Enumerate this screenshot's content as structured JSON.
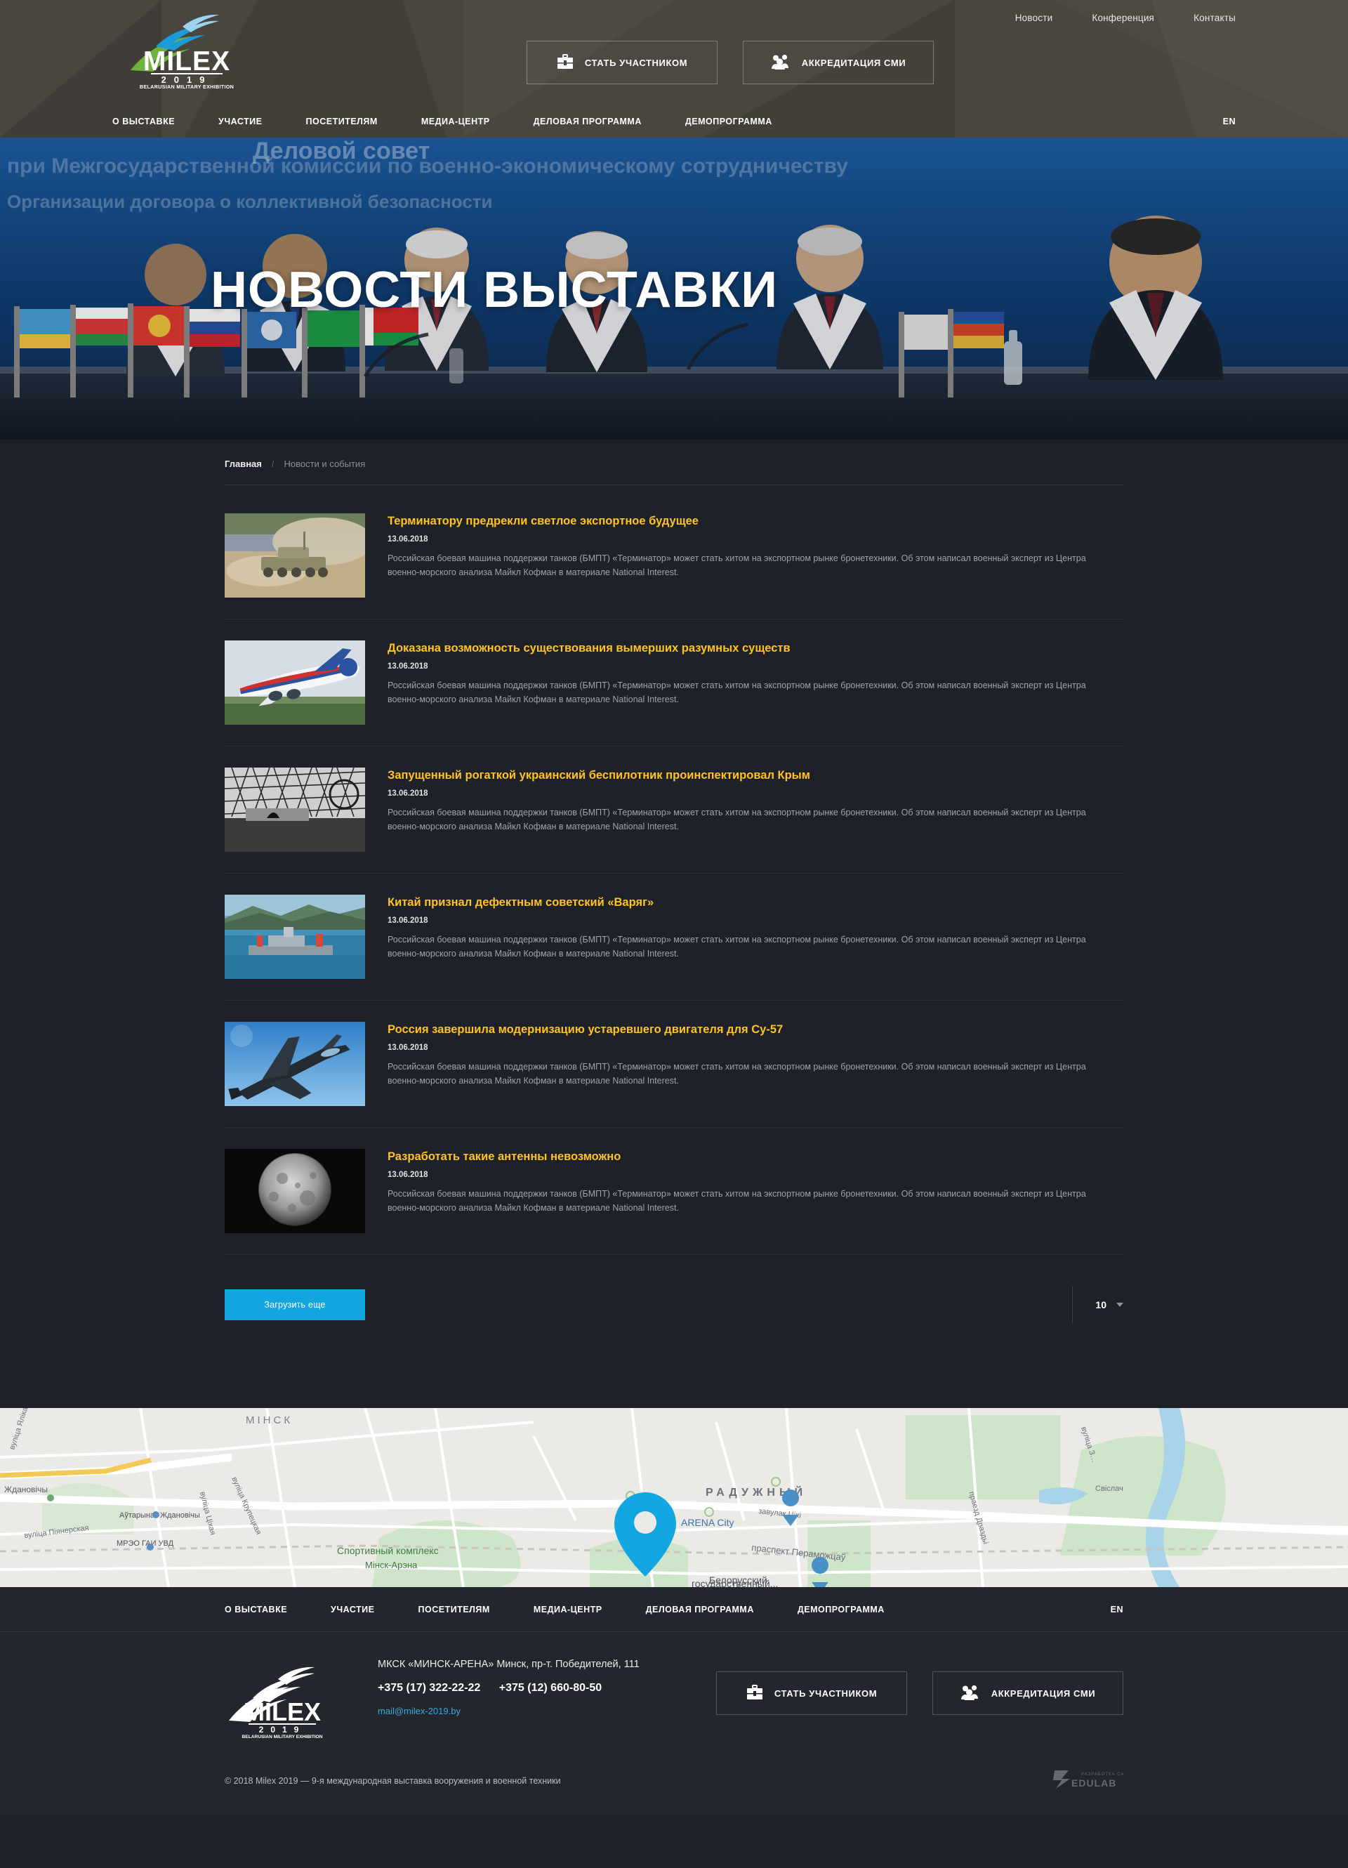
{
  "brand": {
    "name": "MILEX",
    "year": "2019",
    "tagline": "BELARUSIAN MILITARY EXHIBITION"
  },
  "colors": {
    "accent_blue": "#12a5e0",
    "title_yellow": "#ffc31e",
    "header_bg": "#4a463f",
    "page_bg": "#1e2127",
    "footer_bg": "#23262c",
    "link_blue": "#37a8dd"
  },
  "header": {
    "top_links": [
      {
        "label": "Новости"
      },
      {
        "label": "Конференция"
      },
      {
        "label": "Контакты"
      }
    ],
    "cta_buttons": [
      {
        "label": "СТАТЬ УЧАСТНИКОМ",
        "icon": "briefcase-icon"
      },
      {
        "label": "АККРЕДИТАЦИЯ СМИ",
        "icon": "people-icon"
      }
    ],
    "nav": [
      {
        "label": "О ВЫСТАВКЕ"
      },
      {
        "label": "УЧАСТИЕ"
      },
      {
        "label": "ПОСЕТИТЕЛЯМ"
      },
      {
        "label": "МЕДИА-ЦЕНТР"
      },
      {
        "label": "ДЕЛОВАЯ ПРОГРАММА"
      },
      {
        "label": "ДЕМОПРОГРАММА"
      }
    ],
    "lang": "EN"
  },
  "hero": {
    "title": "НОВОСТИ ВЫСТАВКИ"
  },
  "breadcrumb": {
    "home": "Главная",
    "separator": "/",
    "current": "Новости и события"
  },
  "news": {
    "items": [
      {
        "title": "Терминатору предрекли светлое экспортное будущее",
        "date": "13.06.2018",
        "excerpt": "Российская боевая машина поддержки танков (БМПТ) «Терминатор» может стать хитом на экспортном рынке бронетехники. Об этом написал военный эксперт из Центра военно-морского анализа Майкл Кофман в материале National Interest.",
        "thumb": "tank-in-dust"
      },
      {
        "title": "Доказана возможность существования вымерших разумных существ",
        "date": "13.06.2018",
        "excerpt": "Российская боевая машина поддержки танков (БМПТ) «Терминатор» может стать хитом на экспортном рынке бронетехники. Об этом написал военный эксперт из Центра военно-морского анализа Майкл Кофман в материале National Interest.",
        "thumb": "airliner-takeoff"
      },
      {
        "title": "Запущенный рогаткой украинский беспилотник проинспектировал Крым",
        "date": "13.06.2018",
        "excerpt": "Российская боевая машина поддержки танков (БМПТ) «Терминатор» может стать хитом на экспортном рынке бронетехники. Об этом написал военный эксперт из Центра военно-морского анализа Майкл Кофман в материале National Interest.",
        "thumb": "radar-truss-bw"
      },
      {
        "title": "Китай признал дефектным советский «Варяг»",
        "date": "13.06.2018",
        "excerpt": "Российская боевая машина поддержки танков (БМПТ) «Терминатор» может стать хитом на экспортном рынке бронетехники. Об этом написал военный эксперт из Центра военно-морского анализа Майкл Кофман в материале National Interest.",
        "thumb": "warship-bay"
      },
      {
        "title": "Россия завершила модернизацию устаревшего двигателя для Су-57",
        "date": "13.06.2018",
        "excerpt": "Российская боевая машина поддержки танков (БМПТ) «Терминатор» может стать хитом на экспортном рынке бронетехники. Об этом написал военный эксперт из Центра военно-морского анализа Майкл Кофман в материале National Interest.",
        "thumb": "jet-fighter-sky"
      },
      {
        "title": "Разработать такие антенны невозможно",
        "date": "13.06.2018",
        "excerpt": "Российская боевая машина поддержки танков (БМПТ) «Терминатор» может стать хитом на экспортном рынке бронетехники. Об этом написал военный эксперт из Центра военно-морского анализа Майкл Кофман в материале National Interest.",
        "thumb": "dark-sphere"
      }
    ],
    "load_more": "Загрузить еще",
    "per_page": "10"
  },
  "map": {
    "labels": [
      {
        "text": "РАДУЖНЫЙ"
      },
      {
        "text": "ARENA City"
      },
      {
        "text": "Спортивный комплекс"
      },
      {
        "text": "Мінск-Арэна"
      },
      {
        "text": "Белорусский"
      },
      {
        "text": "государственный..."
      },
      {
        "text": "праспект Пераможцаў"
      },
      {
        "text": "вуліца Пiянерская"
      },
      {
        "text": "вуліца Крупецкая"
      },
      {
        "text": "вуліца Ціхая"
      },
      {
        "text": "завулак Ціхі"
      },
      {
        "text": "Свіслач"
      },
      {
        "text": "праезд Драздьі"
      },
      {
        "text": "Ждановічы"
      },
      {
        "text": "Аўтарынак Ждановічы"
      },
      {
        "text": "МРЭО ГАИ УВД"
      },
      {
        "text": "вуліца Ялiка Шырокаева"
      },
      {
        "text": "МІНСК"
      }
    ],
    "marker": "location-pin"
  },
  "footer": {
    "nav": [
      {
        "label": "О ВЫСТАВКЕ"
      },
      {
        "label": "УЧАСТИЕ"
      },
      {
        "label": "ПОСЕТИТЕЛЯМ"
      },
      {
        "label": "МЕДИА-ЦЕНТР"
      },
      {
        "label": "ДЕЛОВАЯ ПРОГРАММА"
      },
      {
        "label": "ДЕМОПРОГРАММА"
      }
    ],
    "lang": "EN",
    "address": "МКСК «МИНСК-АРЕНА» Минск, пр-т. Победителей, 111",
    "phone1": "+375 (17) 322-22-22",
    "phone2": "+375 (12) 660-80-50",
    "email": "mail@milex-2019.by",
    "cta_buttons": [
      {
        "label": "СТАТЬ УЧАСТНИКОМ",
        "icon": "briefcase-icon"
      },
      {
        "label": "АККРЕДИТАЦИЯ СМИ",
        "icon": "people-icon"
      }
    ],
    "copyright": "© 2018  Milex 2019 — 9-я международная выставка вооружения и военной техники",
    "dev_top": "РАЗРАБОТКА САЙТА",
    "dev_name": "EDULAB"
  }
}
